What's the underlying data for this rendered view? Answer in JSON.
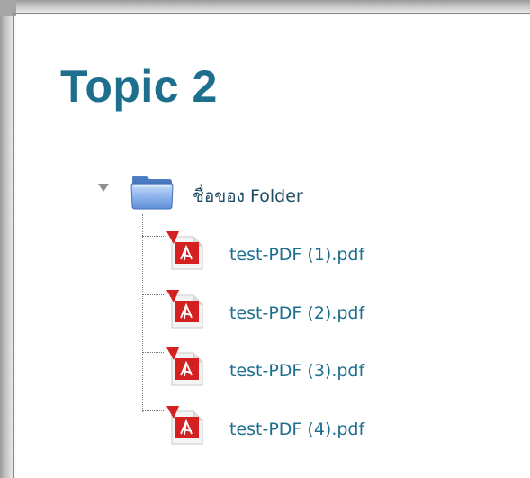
{
  "topic": {
    "title": "Topic 2"
  },
  "folder": {
    "label": "ชื่อของ Folder",
    "expanded": true,
    "toggle_icon": "triangle-down-icon",
    "icon": "folder-icon",
    "icon_color": "#5b8fd6"
  },
  "files": [
    {
      "name": "test-PDF (1).pdf",
      "icon": "pdf-file-icon"
    },
    {
      "name": "test-PDF (2).pdf",
      "icon": "pdf-file-icon"
    },
    {
      "name": "test-PDF (3).pdf",
      "icon": "pdf-file-icon"
    },
    {
      "name": "test-PDF (4).pdf",
      "icon": "pdf-file-icon"
    }
  ],
  "colors": {
    "title": "#1e6f8e",
    "link": "#1e6f8e",
    "pdf_red": "#d42020"
  }
}
